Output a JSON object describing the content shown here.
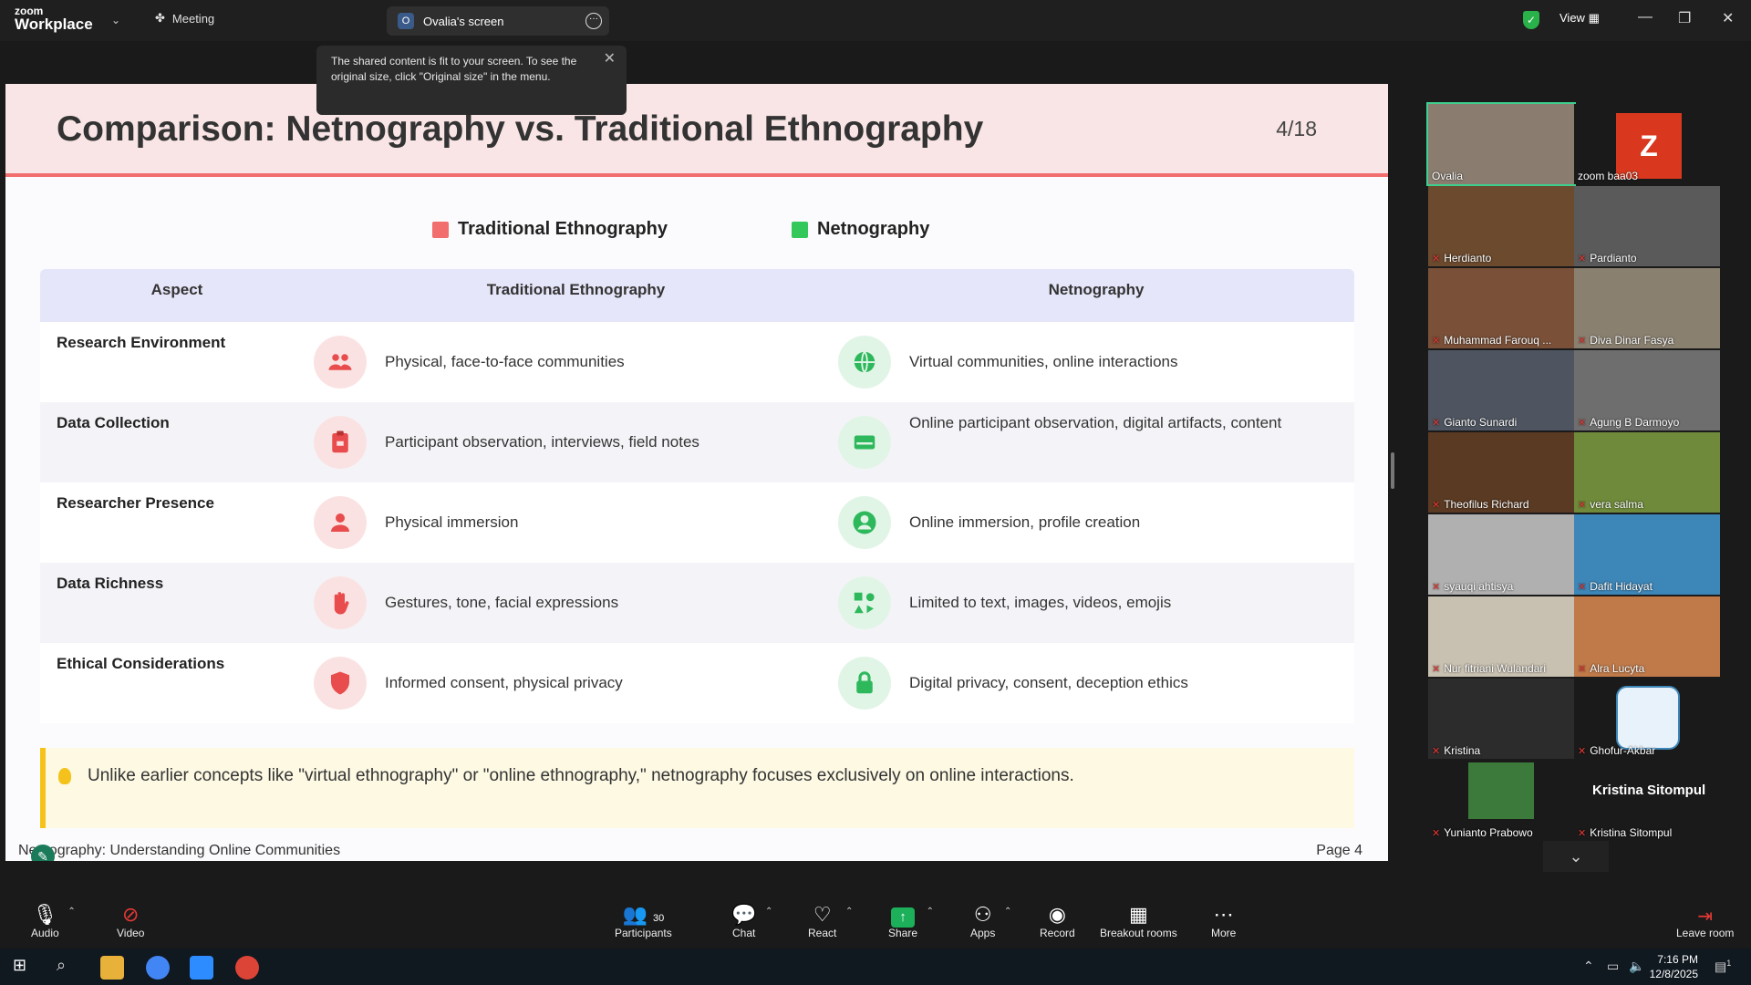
{
  "topbar": {
    "brand_small": "zoom",
    "brand_big": "Workplace",
    "meeting_label": "Meeting",
    "screen_tab_letter": "O",
    "screen_tab_label": "Ovalia's screen",
    "view_label": "View"
  },
  "tooltip": {
    "text": "The shared content is fit to your screen. To see the original size, click \"Original size\" in the menu."
  },
  "slide": {
    "title": "Comparison: Netnography vs. Traditional Ethnography",
    "page_indicator": "4/18",
    "legend_traditional": "Traditional Ethnography",
    "legend_net": "Netnography",
    "legend_traditional_color": "#f26d6d",
    "legend_net_color": "#34c759",
    "headers": [
      "Aspect",
      "Traditional Ethnography",
      "Netnography"
    ],
    "rows": [
      {
        "aspect": "Research Environment",
        "trad_icon": "people-icon",
        "trad": "Physical, face-to-face communities",
        "net_icon": "globe-icon",
        "net": "Virtual communities, online interactions"
      },
      {
        "aspect": "Data Collection",
        "trad_icon": "clipboard-icon",
        "trad": "Participant observation, interviews, field notes",
        "net_icon": "laptop-icon",
        "net": "Online participant observation, digital artifacts, content"
      },
      {
        "aspect": "Researcher Presence",
        "trad_icon": "person-icon",
        "trad": "Physical immersion",
        "net_icon": "user-circle-icon",
        "net": "Online immersion, profile creation"
      },
      {
        "aspect": "Data Richness",
        "trad_icon": "hand-icon",
        "trad": "Gestures, tone, facial expressions",
        "net_icon": "media-icon",
        "net": "Limited to text, images, videos, emojis"
      },
      {
        "aspect": "Ethical Considerations",
        "trad_icon": "shield-icon",
        "trad": "Informed consent, physical privacy",
        "net_icon": "lock-icon",
        "net": "Digital privacy, consent, deception ethics"
      }
    ],
    "note": "Unlike earlier concepts like \"virtual ethnography\" or \"online ethnography,\" netnography focuses exclusively on online interactions.",
    "footer_left": "Netnography: Understanding Online Communities",
    "footer_right": "Page 4"
  },
  "participants": [
    {
      "name": "Ovalia",
      "muted": false,
      "active": true
    },
    {
      "name": "zoom baa03",
      "muted": false,
      "avatar_letter": "Z"
    },
    {
      "name": "Herdianto",
      "muted": true
    },
    {
      "name": "Pardianto",
      "muted": true
    },
    {
      "name": "Muhammad Farouq ...",
      "muted": true
    },
    {
      "name": "Diva Dinar Fasya",
      "muted": true
    },
    {
      "name": "Gianto Sunardi",
      "muted": true
    },
    {
      "name": "Agung B Darmoyo",
      "muted": true
    },
    {
      "name": "Theofilus Richard",
      "muted": true
    },
    {
      "name": "vera salma",
      "muted": true
    },
    {
      "name": "syauqi ahtisya",
      "muted": true
    },
    {
      "name": "Dafit Hidayat",
      "muted": true
    },
    {
      "name": "Nur fitriani Wulandari",
      "muted": true
    },
    {
      "name": "Alra Lucyta",
      "muted": true
    },
    {
      "name": "Kristina",
      "muted": true
    },
    {
      "name": "Ghofur-Akbar",
      "muted": true
    },
    {
      "name": "Yunianto Prabowo",
      "muted": true
    },
    {
      "name": "Kristina Sitompul",
      "muted": true,
      "big_name": "Kristina Sitompul"
    }
  ],
  "toolbar": {
    "audio": "Audio",
    "video": "Video",
    "participants": "Participants",
    "participants_count": "30",
    "chat": "Chat",
    "react": "React",
    "share": "Share",
    "apps": "Apps",
    "record": "Record",
    "breakout": "Breakout rooms",
    "more": "More",
    "leave": "Leave room"
  },
  "taskbar": {
    "time": "7:16 PM",
    "date": "12/8/2025",
    "notification_count": "1"
  }
}
